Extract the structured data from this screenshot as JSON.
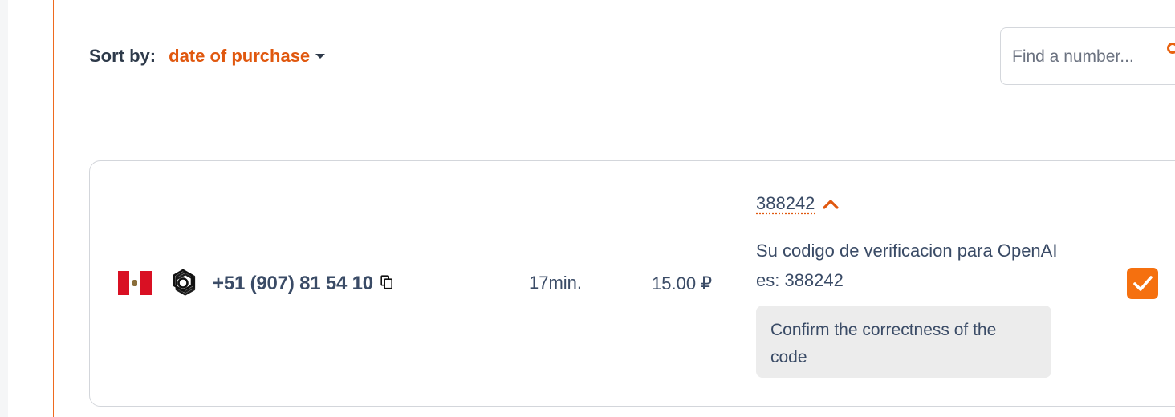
{
  "sort": {
    "label": "Sort by:",
    "value": "date of purchase"
  },
  "search": {
    "placeholder": "Find a number..."
  },
  "order": {
    "country_flag": "peru-flag",
    "service_icon": "openai-icon",
    "phone": "+51 (907) 81 54 10",
    "time": "17min.",
    "price": "15.00 ₽",
    "code": "388242",
    "sms": "Su codigo de verificacion para OpenAI es: 388242",
    "confirm": "Confirm the correctness of the code",
    "checked": true
  },
  "colors": {
    "accent": "#e0580f",
    "checkbox": "#f5700f",
    "text": "#3a4b66"
  }
}
